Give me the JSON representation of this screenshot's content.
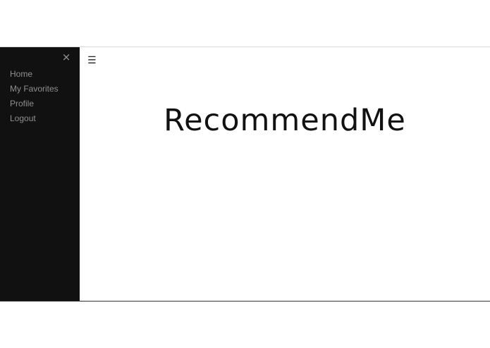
{
  "sidebar": {
    "close_icon": "×",
    "items": [
      {
        "label": "Home"
      },
      {
        "label": "My Favorites"
      },
      {
        "label": "Profile"
      },
      {
        "label": "Logout"
      }
    ]
  },
  "main": {
    "menu_icon": "☰",
    "title": "RecommendMe"
  },
  "colors": {
    "sidebar_bg": "#111111",
    "nav_text": "#8f8f8f",
    "title_text": "#111111"
  }
}
